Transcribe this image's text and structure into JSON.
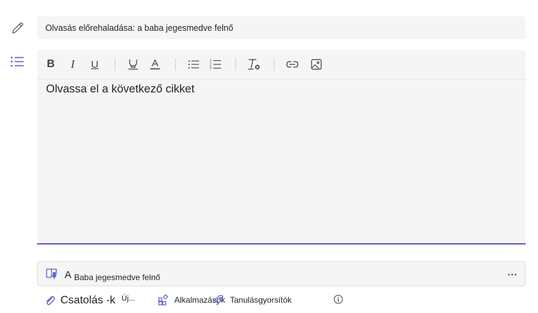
{
  "title": {
    "value": "Olvasás előrehaladása: a baba jegesmedve felnő"
  },
  "editor": {
    "content": "Olvassa el a következő cikket",
    "toolbar": {
      "bold": "B",
      "italic": "I",
      "underline": "U"
    },
    "accent_color": "#5b5fc7"
  },
  "reference": {
    "prefix": "A",
    "name": "Baba jegesmedve felnő",
    "more": "..."
  },
  "actions": {
    "attach": "Csatolás -k",
    "new": "Új...",
    "apps": "Alkalmazások",
    "learning": "Tanulásgyorsítók"
  },
  "icons": {
    "title": "pencil-icon",
    "instructions": "list-icon",
    "reference": "reading-progress-icon",
    "attach": "paperclip-icon",
    "apps": "apps-icon",
    "learning": "rocket-icon",
    "info": "info-icon"
  }
}
